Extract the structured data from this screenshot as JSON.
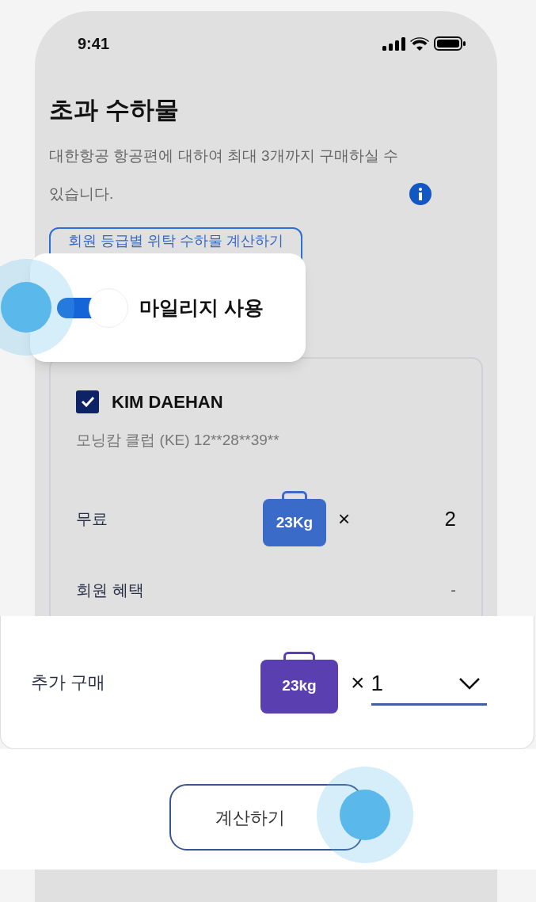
{
  "status_bar": {
    "time": "9:41"
  },
  "title": "초과 수하물",
  "description": "대한항공 항공편에 대하여 최대 3개까지 구매하실 수 있습니다.",
  "member_calc_button": "회원 등급별 위탁 수하물 계산하기",
  "mileage_toggle": {
    "label": "마일리지 사용",
    "on": true
  },
  "passenger": {
    "name": "KIM DAEHAN",
    "checked": true,
    "membership": "모닝캄 클럽 (KE) 12**28**39**",
    "rows": [
      {
        "kind": "baggage",
        "label": "무료",
        "bag": "23Kg",
        "times": "×",
        "count": "2"
      },
      {
        "kind": "plain",
        "label": "회원 혜택",
        "value": "-"
      }
    ]
  },
  "purchase": {
    "label": "추가 구매",
    "bag": "23kg",
    "times": "×",
    "quantity": "1"
  },
  "calculate_button": "계산하기"
}
